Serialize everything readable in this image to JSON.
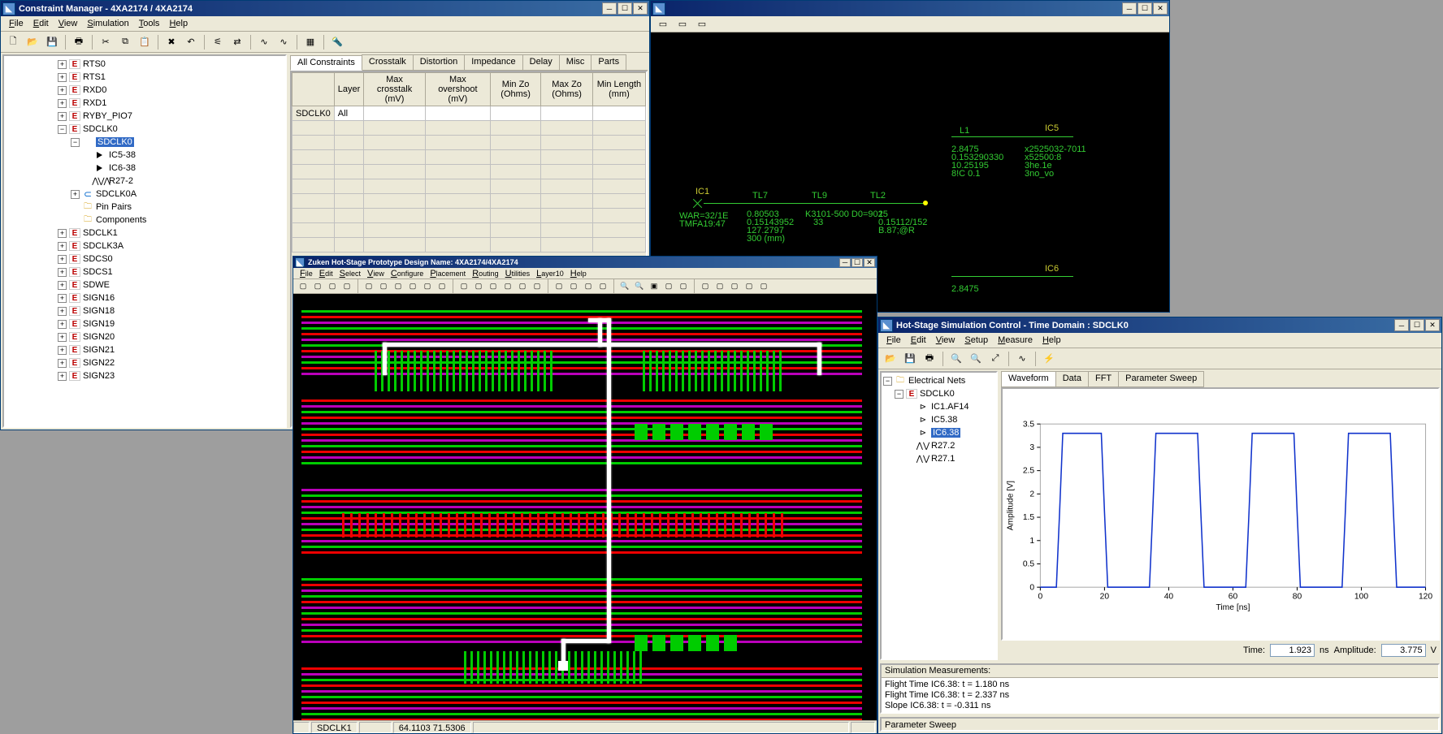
{
  "cm": {
    "title": "Constraint Manager - 4XA2174 / 4XA2174",
    "menus": [
      "File",
      "Edit",
      "View",
      "Simulation",
      "Tools",
      "Help"
    ],
    "tree": [
      {
        "lvl": 4,
        "exp": "+",
        "ic": "net",
        "lbl": "RTS0"
      },
      {
        "lvl": 4,
        "exp": "+",
        "ic": "net",
        "lbl": "RTS1"
      },
      {
        "lvl": 4,
        "exp": "+",
        "ic": "net",
        "lbl": "RXD0"
      },
      {
        "lvl": 4,
        "exp": "+",
        "ic": "net",
        "lbl": "RXD1"
      },
      {
        "lvl": 4,
        "exp": "+",
        "ic": "net",
        "lbl": "RYBY_PIO7"
      },
      {
        "lvl": 4,
        "exp": "-",
        "ic": "net",
        "lbl": "SDCLK0"
      },
      {
        "lvl": 5,
        "exp": "-",
        "ic": "",
        "lbl": "SDCLK0",
        "sel": true
      },
      {
        "lvl": 6,
        "exp": "",
        "ic": "drv",
        "lbl": "IC5-38"
      },
      {
        "lvl": 6,
        "exp": "",
        "ic": "drv",
        "lbl": "IC6-38"
      },
      {
        "lvl": 6,
        "exp": "",
        "ic": "res",
        "lbl": "R27-2"
      },
      {
        "lvl": 5,
        "exp": "+",
        "ic": "sect",
        "lbl": "SDCLK0A"
      },
      {
        "lvl": 5,
        "exp": "",
        "ic": "fld",
        "lbl": "Pin Pairs"
      },
      {
        "lvl": 5,
        "exp": "",
        "ic": "fld",
        "lbl": "Components"
      },
      {
        "lvl": 4,
        "exp": "+",
        "ic": "net",
        "lbl": "SDCLK1"
      },
      {
        "lvl": 4,
        "exp": "+",
        "ic": "net",
        "lbl": "SDCLK3A"
      },
      {
        "lvl": 4,
        "exp": "+",
        "ic": "net",
        "lbl": "SDCS0"
      },
      {
        "lvl": 4,
        "exp": "+",
        "ic": "net",
        "lbl": "SDCS1"
      },
      {
        "lvl": 4,
        "exp": "+",
        "ic": "net",
        "lbl": "SDWE"
      },
      {
        "lvl": 4,
        "exp": "+",
        "ic": "net",
        "lbl": "SIGN16"
      },
      {
        "lvl": 4,
        "exp": "+",
        "ic": "net",
        "lbl": "SIGN18"
      },
      {
        "lvl": 4,
        "exp": "+",
        "ic": "net",
        "lbl": "SIGN19"
      },
      {
        "lvl": 4,
        "exp": "+",
        "ic": "net",
        "lbl": "SIGN20"
      },
      {
        "lvl": 4,
        "exp": "+",
        "ic": "net",
        "lbl": "SIGN21"
      },
      {
        "lvl": 4,
        "exp": "+",
        "ic": "net",
        "lbl": "SIGN22"
      },
      {
        "lvl": 4,
        "exp": "+",
        "ic": "net",
        "lbl": "SIGN23"
      }
    ],
    "gridTabs": [
      "All Constraints",
      "Crosstalk",
      "Distortion",
      "Impedance",
      "Delay",
      "Misc",
      "Parts"
    ],
    "gridTabActive": 0,
    "gridCols": [
      "",
      "Layer",
      "Max crosstalk (mV)",
      "Max overshoot (mV)",
      "Min Zo (Ohms)",
      "Max Zo (Ohms)",
      "Min Length (mm)"
    ],
    "gridRows": [
      [
        "SDCLK0",
        "All",
        "",
        "",
        "",
        "",
        ""
      ]
    ]
  },
  "topo": {
    "title": "",
    "labels": {
      "ic1": "IC1",
      "tl7": "TL7",
      "tl9": "TL9",
      "tl2": "TL2",
      "ic5_ref": "IC5",
      "ic6_ref": "IC6",
      "l1": "L1",
      "net_left_a": "WAR=32/1E",
      "net_left_b": "TMFA19:47",
      "val_tl7_a": "0.80503",
      "val_tl7_b": "0.15143952",
      "val_tl7_c": "127.2797",
      "val_tl7_d": "300 (mm)",
      "val_tl9_a": "K3101-500 D0=9025",
      "val_tl9_b": "33",
      "val_tl2_a": "1",
      "val_tl2_b": "0.15112/152",
      "val_tl2_c": "B.87;@R",
      "val_l1_a": "2.8475",
      "val_l1_b": "0.153290330",
      "val_l1_c": "10.25195",
      "val_l1_d": "8!C 0.1",
      "val_l2_a": "2.8475",
      "right_a": "x2525032-7011",
      "right_b": "x52500:8",
      "right_c": "3he.1e",
      "right_d": "3no_vo"
    }
  },
  "pcb": {
    "title": "Zuken Hot-Stage Prototype   Design Name: 4XA2174/4XA2174",
    "menus": [
      "File",
      "Edit",
      "Select",
      "View",
      "Configure",
      "Placement",
      "Routing",
      "Utilities",
      "Layer10",
      "Help"
    ],
    "status": {
      "net": "SDCLK1",
      "coord": "64.1103  71.5306"
    }
  },
  "sim": {
    "title": "Hot-Stage Simulation Control - Time Domain : SDCLK0",
    "menus": [
      "File",
      "Edit",
      "View",
      "Setup",
      "Measure",
      "Help"
    ],
    "tree": {
      "root": "Electrical Nets",
      "net": "SDCLK0",
      "pins": [
        "IC1.AF14",
        "IC5.38",
        "IC6.38",
        "R27.2",
        "R27.1"
      ],
      "sel": "IC6.38"
    },
    "tabs": [
      "Waveform",
      "Data",
      "FFT",
      "Parameter Sweep"
    ],
    "tabActive": 0,
    "readout": {
      "time_lbl": "Time:",
      "time_val": "1.923",
      "time_u": "ns",
      "amp_lbl": "Amplitude:",
      "amp_val": "3.775",
      "amp_u": "V"
    },
    "meas": {
      "hdr": "Simulation Measurements:",
      "rows": [
        "Flight Time IC6.38: t = 1.180 ns",
        "Flight Time IC6.38: t = 2.337 ns",
        "Slope IC6.38: t = -0.311 ns"
      ]
    },
    "ps": "Parameter Sweep"
  },
  "chart_data": {
    "type": "line",
    "title": "",
    "xlabel": "Time [ns]",
    "ylabel": "Amplitude [V]",
    "xlim": [
      0,
      120
    ],
    "ylim": [
      0,
      3.5
    ],
    "xticks": [
      0,
      20,
      40,
      60,
      80,
      100,
      120
    ],
    "yticks": [
      0,
      0.5,
      1,
      1.5,
      2,
      2.5,
      3,
      3.5
    ],
    "series": [
      {
        "name": "IC6.38",
        "x": [
          0,
          5,
          6,
          7,
          19,
          20,
          21,
          34,
          35,
          36,
          49,
          50,
          51,
          64,
          65,
          66,
          79,
          80,
          81,
          94,
          95,
          96,
          109,
          110,
          111,
          120
        ],
        "y": [
          0,
          0,
          1.6,
          3.3,
          3.3,
          1.6,
          0,
          0,
          1.6,
          3.3,
          3.3,
          1.6,
          0,
          0,
          1.6,
          3.3,
          3.3,
          1.6,
          0,
          0,
          1.6,
          3.3,
          3.3,
          1.6,
          0,
          0
        ]
      }
    ]
  }
}
